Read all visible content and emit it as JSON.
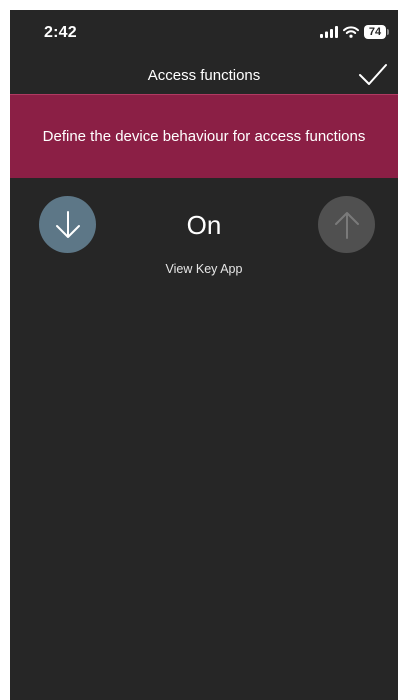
{
  "status_bar": {
    "time": "2:42",
    "battery": "74",
    "icons": [
      "signal-icon",
      "wifi-icon",
      "battery-icon"
    ]
  },
  "header": {
    "title": "Access functions",
    "confirm_icon": "checkmark-icon"
  },
  "banner": {
    "text": "Define the device behaviour for access functions",
    "color": "#8b1f45"
  },
  "control": {
    "value": "On",
    "down_icon": "arrow-down-icon",
    "up_icon": "arrow-up-icon",
    "down_color": "#5d7787",
    "up_color": "#505050"
  },
  "subtitle": "View Key App",
  "colors": {
    "background": "#262626",
    "text": "#ffffff"
  }
}
